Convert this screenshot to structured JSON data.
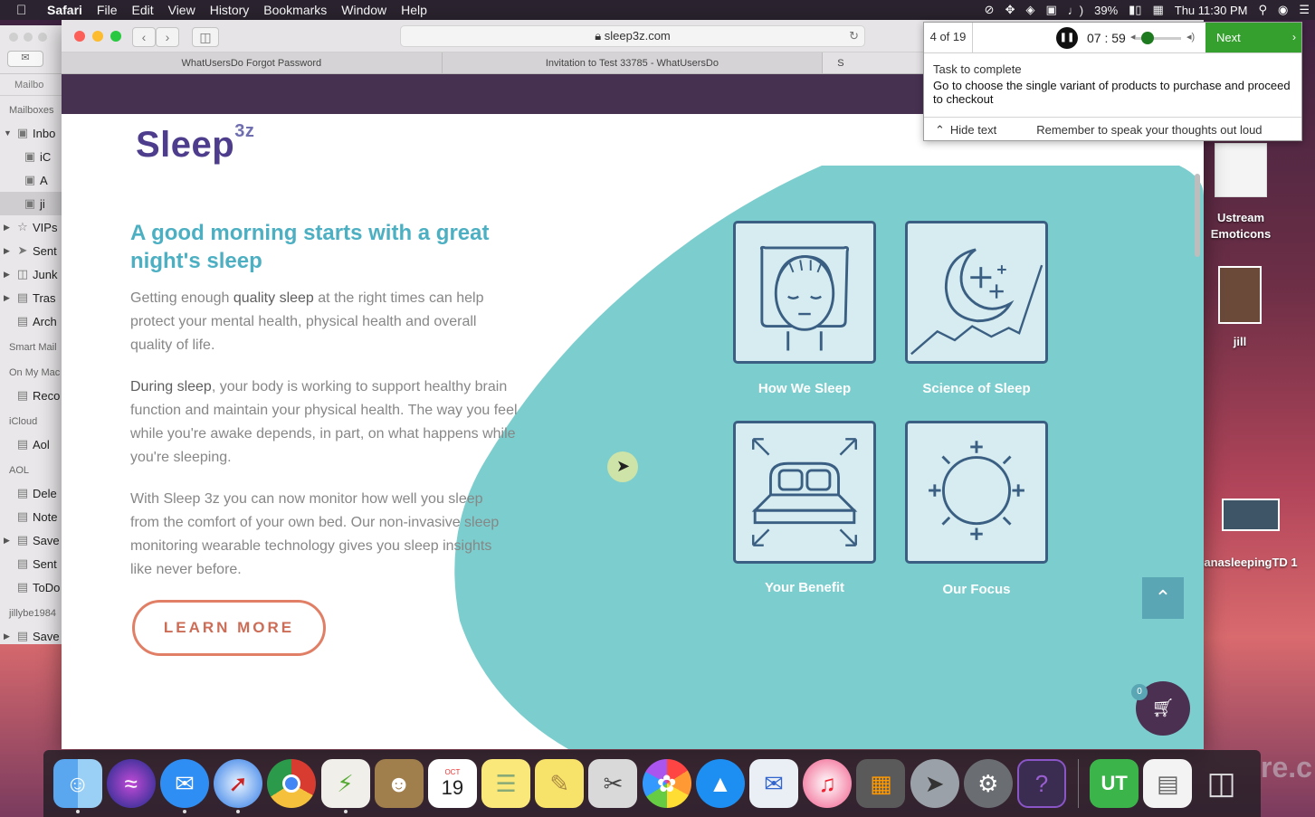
{
  "menubar": {
    "app": "Safari",
    "items": [
      "File",
      "Edit",
      "View",
      "History",
      "Bookmarks",
      "Window",
      "Help"
    ],
    "battery": "39%",
    "clock": "Thu 11:30 PM"
  },
  "mail": {
    "tab": "Mailbo",
    "sections": {
      "mailboxes": "Mailboxes",
      "smart": "Smart Mail",
      "mymac": "On My Mac",
      "icloud": "iCloud",
      "aol": "AOL",
      "jilly": "jillybe1984"
    },
    "items": {
      "inbox": "Inbo",
      "ic": "iC",
      "a": "A",
      "ji": "ji",
      "vips": "VIPs",
      "sent": "Sent",
      "junk": "Junk",
      "trash": "Tras",
      "archive": "Arch",
      "recovered": "Reco",
      "aol_icloud": "Aol",
      "deleted": "Dele",
      "notes": "Note",
      "saved": "Save",
      "sent2": "Sent",
      "todo": "ToDo",
      "saved2": "Save"
    }
  },
  "safari": {
    "url": "sleep3z.com",
    "tabs": [
      "WhatUsersDo Forgot Password",
      "Invitation to Test 33785 - WhatUsersDo",
      "S"
    ]
  },
  "page": {
    "logo": "Sleep",
    "logo_sup": "3z",
    "hero_title": "A good morning starts with a great night's sleep",
    "p1_a": "Getting enough ",
    "p1_b": "quality sleep",
    "p1_c": " at the right times can help protect your mental health, physical health and overall quality of life.",
    "p2_a": "During sleep",
    "p2_b": ", your body is working to support healthy brain function and maintain your physical health. The way you feel while you're awake depends, in part, on what happens while you're sleeping.",
    "p3": "With Sleep 3z you can now monitor how well you sleep from the comfort of your own bed. Our non-invasive sleep monitoring wearable technology gives you sleep insights like never before.",
    "learn_more": "LEARN MORE",
    "cards": [
      {
        "label": "How We Sleep",
        "icon": "sleeping-face-icon"
      },
      {
        "label": "Science of Sleep",
        "icon": "moon-stars-icon"
      },
      {
        "label": "Your Benefit",
        "icon": "bed-icon"
      },
      {
        "label": "Our Focus",
        "icon": "sun-icon"
      }
    ],
    "cart_count": "0",
    "colors": {
      "accent": "#4cafc2",
      "blob": "#7ccdcd",
      "brand": "#473151",
      "button": "#e17f66"
    }
  },
  "task": {
    "counter": "4 of 19",
    "timer": "07 : 59",
    "next": "Next",
    "label": "Task to complete",
    "text": "Go to choose the single variant of products to purchase and proceed to checkout",
    "hide": "Hide text",
    "remember": "Remember to speak your thoughts out loud"
  },
  "desktop": {
    "icons": [
      {
        "label": "Ustream Emoticons"
      },
      {
        "label": "jill"
      },
      {
        "label": "anasleepingTD 1"
      }
    ],
    "ghost": "re.c"
  },
  "dock": {
    "apps": [
      "Finder",
      "Siri",
      "Messages",
      "Safari",
      "Chrome",
      "Preview",
      "Contacts",
      "Calendar",
      "Notes",
      "Stickies",
      "Photo Booth",
      "Photos",
      "App Store",
      "Mail",
      "iTunes",
      "Calculator",
      "Launchpad",
      "System Preferences",
      "Help",
      "UserTesting",
      "Documents",
      "Trash"
    ],
    "calendar_month": "OCT",
    "calendar_day": "19"
  }
}
